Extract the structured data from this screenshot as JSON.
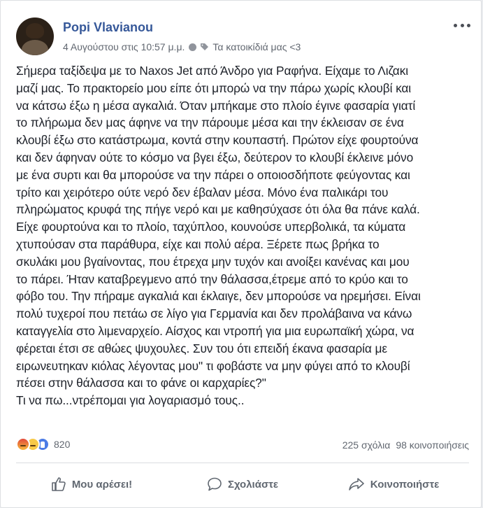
{
  "post": {
    "author": "Popi Vlavianou",
    "date": "4 Αυγούστου στις 10:57 μ.μ.",
    "group": "Τα κατοικίδιά μας <3",
    "text": "Σήμερα ταξίδεψα με το Naxos Jet από Άνδρο για Ραφήνα. Είχαμε το Λιζακι\nμαζί μας. Το πρακτορείο μου είπε ότι μπορώ να την πάρω χωρίς κλουβί και\nνα κάτσω έξω η μέσα αγκαλιά. Όταν μπήκαμε στο πλοίο έγινε φασαρία γιατί\nτο πλήρωμα δεν μας άφηνε να την πάρουμε μέσα και την έκλεισαν σε ένα\nκλουβί έξω στο κατάστρωμα, κοντά στην κουπαστή. Πρώτον είχε φουρτούνα\nκαι δεν άφηναν ούτε το κόσμο να βγει έξω, δεύτερον το κλουβί έκλεινε μόνο\nμε ένα συρτι και θα μπορούσε να την πάρει ο οποιοσδήποτε φεύγοντας και\nτρίτο και χειρότερο ούτε νερό δεν έβαλαν μέσα. Μόνο ένα παλικάρι του\nπληρώματος κρυφά της πήγε νερό και με καθησύχασε ότι όλα θα πάνε καλά.\nΕίχε φουρτούνα και το πλοίο, ταχύπλοο, κουνούσε υπερβολικά, τα κύματα\nχτυπούσαν στα παράθυρα, είχε και πολύ αέρα. Ξέρετε πως βρήκα το\nσκυλάκι μου βγαίνοντας, που έτρεχα μην τυχόν και ανοίξει κανένας και μου\nτο πάρει. Ήταν καταβρεγμενο από την θάλασσα,έτρεμε από το κρύο και το\nφόβο του. Την πήραμε αγκαλιά και έκλαιγε, δεν μπορούσε να ηρεμήσει. Είναι\nπολύ τυχεροί που πετάω σε λίγο για Γερμανία και δεν προλάβαινα να κάνω\nκαταγγελία στο λιμεναρχείο. Αίσχος και ντροπή για μια ευρωπαϊκή χώρα, να\nφέρεται έτσι σε αθώες ψυχουλες. Συν του ότι επειδή έκανα φασαρία με\nειρωνευτηκαν κιόλας λέγοντας μου\" τι φοβάστε να μην φύγει από το κλουβί\nπέσει στην θάλασσα και το φάνε οι καρχαρίες?\"\nΤι να πω...ντρέπομαι για λογαριασμό τους..",
    "reactions": {
      "icons": [
        "angry-reaction-icon",
        "sad-reaction-icon",
        "like-reaction-icon"
      ],
      "count": "820"
    },
    "comments": "225 σχόλια",
    "shares": "98 κοινοποιήσεις"
  },
  "actions": {
    "like": "Μου αρέσει!",
    "comment": "Σχολιάστε",
    "share": "Κοινοποιήστε"
  },
  "colors": {
    "author": "#365899",
    "text": "#1d2129",
    "muted": "#616770",
    "background": "#e9ebee"
  }
}
